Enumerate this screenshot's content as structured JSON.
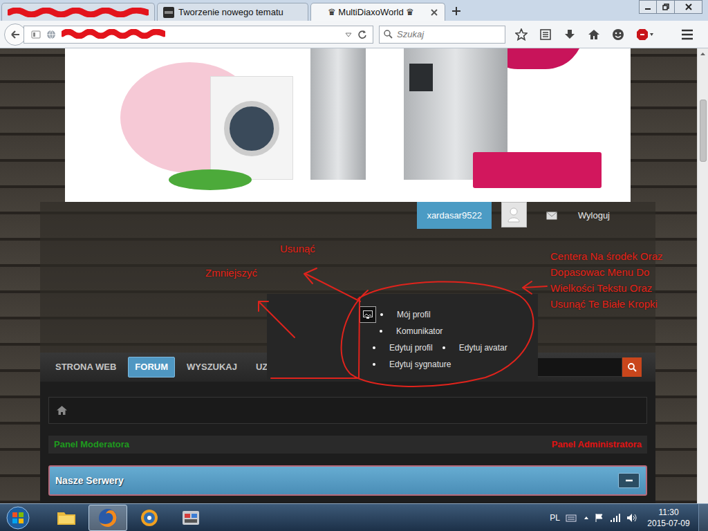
{
  "browser": {
    "tabs": [
      {
        "redacted": true,
        "selected": false
      },
      {
        "label": "Tworzenie nowego tematu",
        "selected": false
      },
      {
        "label": "♛ MultiDiaxoWorld ♛",
        "selected": true
      }
    ],
    "address": {
      "redacted": true
    },
    "search": {
      "placeholder": "Szukaj"
    }
  },
  "forum": {
    "user": {
      "username": "xardasar9522",
      "logout": "Wyloguj"
    },
    "user_menu": {
      "open": true,
      "items": [
        {
          "label": "Mój profil"
        },
        {
          "label": "Komunikator"
        },
        {
          "label": "Edytuj profil"
        },
        {
          "label": "Edytuj avatar"
        },
        {
          "label": "Edytuj sygnature"
        }
      ]
    },
    "nav": {
      "items": [
        {
          "label": "STRONA WEB",
          "selected": false
        },
        {
          "label": "FORUM",
          "selected": true
        },
        {
          "label": "WYSZUKAJ",
          "selected": false
        },
        {
          "label": "UZYT",
          "selected": false
        }
      ]
    },
    "moderator_panel": "Panel Moderatora",
    "admin_panel": "Panel Administratora",
    "category": {
      "title": "Nasze Serwery",
      "expanded": true
    }
  },
  "annotations": [
    {
      "text": "Usunąć"
    },
    {
      "text": "Zmniejszyć"
    },
    {
      "text": "Centera Na środek Oraz Dopasowac Menu Do Wielkości Tekstu Oraz Usunąć Te Białe Kropki"
    }
  ],
  "taskbar": {
    "apps": [
      {
        "kind": "explorer",
        "active": false
      },
      {
        "kind": "firefox",
        "active": true
      },
      {
        "kind": "itunes",
        "active": false
      },
      {
        "kind": "tool",
        "active": false
      }
    ],
    "language": "PL",
    "time": "11:30",
    "date": "2015-07-09"
  }
}
